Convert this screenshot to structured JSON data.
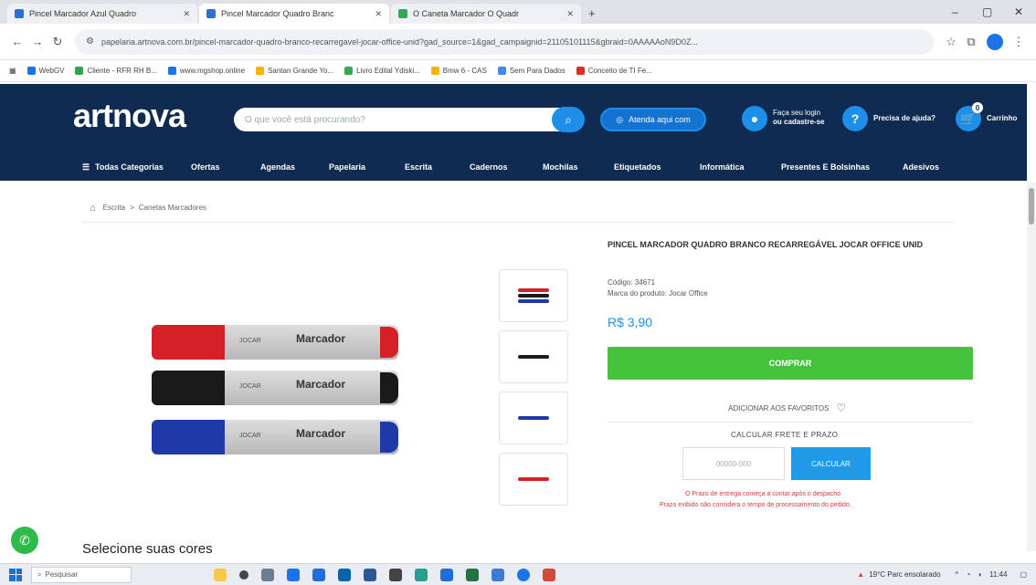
{
  "browser": {
    "tabs": [
      {
        "label": "Pincel Marcador Azul Quadro"
      },
      {
        "label": "Pincel Marcador Quadro Branc"
      },
      {
        "label": "O Caneta Marcador O Quadr"
      }
    ],
    "new_tab": "+",
    "window_controls": [
      "–",
      "▢",
      "✕"
    ],
    "url": "papelaria.artnova.com.br/pincel-marcador-quadro-branco-recarregavel-jocar-office-unid?gad_source=1&gad_campaignid=21105101115&gbraid=0AAAAAoN9D0Z...",
    "bookmarks": [
      {
        "label": "WebGV",
        "color": "#1a73e8"
      },
      {
        "label": "Cliente - RFR RH B...",
        "color": "#2ea44f"
      },
      {
        "label": "www.mgshop.online",
        "color": "#1a73e8"
      },
      {
        "label": "Santan Grande Yo...",
        "color": "#f4b400"
      },
      {
        "label": "Livro Edital Ydiski...",
        "color": "#34a853"
      },
      {
        "label": "Bmw 6 - CAS",
        "color": "#f4b400"
      },
      {
        "label": "Sem Para Dados",
        "color": "#4285f4"
      },
      {
        "label": "Conceito de TI Fe...",
        "color": "#d93025"
      }
    ]
  },
  "site": {
    "logo": "artnova",
    "search_placeholder": "O que você está procurando?",
    "online_button": "Atenda aqui com",
    "login_line1": "Faça seu login",
    "login_line2": "ou cadastre-se",
    "help_text": "Precisa de ajuda?",
    "cart_text": "Carrinho",
    "cart_count": "0",
    "categories": [
      "Todas Categorias",
      "Ofertas",
      "Agendas",
      "Papelaria",
      "Escrita",
      "Cadernos",
      "Mochilas",
      "Etiquetados",
      "Informática",
      "Presentes E Bolsinhas",
      "Adesivos"
    ]
  },
  "breadcrumb": {
    "items": [
      "Escrita",
      "Canetas Marcadores"
    ],
    "separator": ">"
  },
  "product": {
    "title": "PINCEL MARCADOR QUADRO BRANCO RECARREGÁVEL JOCAR OFFICE UNID",
    "code": "Código: 34671",
    "brand": "Marca do produto: Jocar Office",
    "price": "R$ 3,90",
    "buy_button": "COMPRAR",
    "wishlist": "ADICIONAR AOS FAVORITOS",
    "calc_label": "CALCULAR FRETE E PRAZO",
    "cep_placeholder": "00000-000",
    "calc_button": "CALCULAR",
    "note1": "O Prazo de entrega começa a contar após o despacho",
    "note2": "Prazo exibido não considera o tempo de processamento do pedido.",
    "marker_label": "Marcador",
    "marker_brand": "JOCAR",
    "marker_colors": [
      "#d62027",
      "#1a1a1a",
      "#1f3aa8"
    ]
  },
  "select_colors": "Selecione suas cores",
  "taskbar": {
    "search": "Pesquisar",
    "weather": "19°C Parc ensolarado",
    "time": "11:44"
  }
}
